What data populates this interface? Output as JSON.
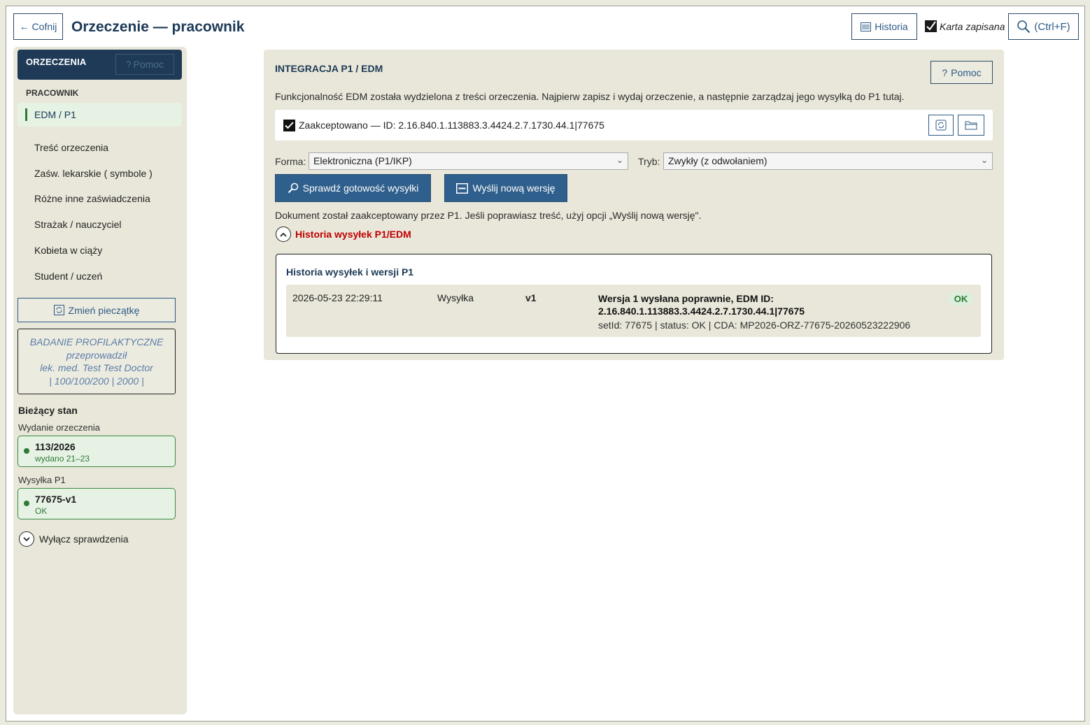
{
  "header": {
    "back_label": "← Cofnij",
    "title": "Orzeczenie — pracownik",
    "history_label": "Historia",
    "saved_status": "Karta zapisana",
    "search_label": "(Ctrl+F)"
  },
  "sidebar": {
    "title": "ORZECZENIA",
    "help_label": "Pomoc",
    "section": "PRACOWNIK",
    "items": [
      {
        "label": "EDM / P1"
      },
      {
        "label": "Treść orzeczenia"
      },
      {
        "label": "Zaśw. lekarskie ( symbole )"
      },
      {
        "label": "Różne inne zaświadczenia"
      },
      {
        "label": "Strażak / nauczyciel"
      },
      {
        "label": "Kobieta w ciąży"
      },
      {
        "label": "Student / uczeń"
      }
    ],
    "change_stamp_label": "Zmień pieczątkę",
    "stamp": {
      "line1": "BADANIE PROFILAKTYCZNE",
      "line2": "przeprowadził",
      "line3": "lek. med. Test Test Doctor",
      "line4": "| 100/100/200 | 2000 |"
    },
    "current_state_label": "Bieżący stan",
    "issue_label": "Wydanie orzeczenia",
    "issue_card": {
      "main": "113/2026",
      "sub": "wydano 21–23"
    },
    "send_label": "Wysyłka P1",
    "send_card": {
      "main": "77675-v1",
      "sub": "OK"
    },
    "toggle_checks_label": "Wyłącz sprawdzenia"
  },
  "panel": {
    "title": "INTEGRACJA P1 / EDM",
    "help_label": "Pomoc",
    "info": "Funkcjonalność EDM została wydzielona z treści orzeczenia. Najpierw zapisz i wydaj orzeczenie, a następnie zarządzaj jego wysyłką do P1 tutaj.",
    "accepted_text": "Zaakceptowano — ID: 2.16.840.1.113883.3.4424.2.7.1730.44.1|77675",
    "form_label": "Forma:",
    "form_value": "Elektroniczna (P1/IKP)",
    "mode_label": "Tryb:",
    "mode_value": "Zwykły (z odwołaniem)",
    "check_ready_label": "Sprawdź gotowość wysyłki",
    "send_new_label": "Wyślij nową wersję",
    "doc_note": "Dokument został zaakceptowany przez P1. Jeśli poprawiasz treść, użyj opcji „Wyślij nową wersję\".",
    "history_toggle_label": "Historia wysyłek P1/EDM",
    "history": {
      "title": "Historia wysyłek i wersji P1",
      "rows": [
        {
          "datetime": "2026-05-23 22:29:11",
          "type": "Wysyłka",
          "version": "v1",
          "message": "Wersja 1 wysłana poprawnie, EDM ID: 2.16.840.1.113883.3.4424.2.7.1730.44.1|77675",
          "meta": "setId:  77675   | status:  OK   | CDA:  MP2026-ORZ-77675-20260523222906",
          "badge": "OK"
        }
      ]
    }
  },
  "colors": {
    "accent": "#1e3a57",
    "primary_button": "#2f5f8c",
    "ok_green": "#2d7a36",
    "alert_red": "#c00000",
    "panel_bg": "#e9e7d9"
  }
}
